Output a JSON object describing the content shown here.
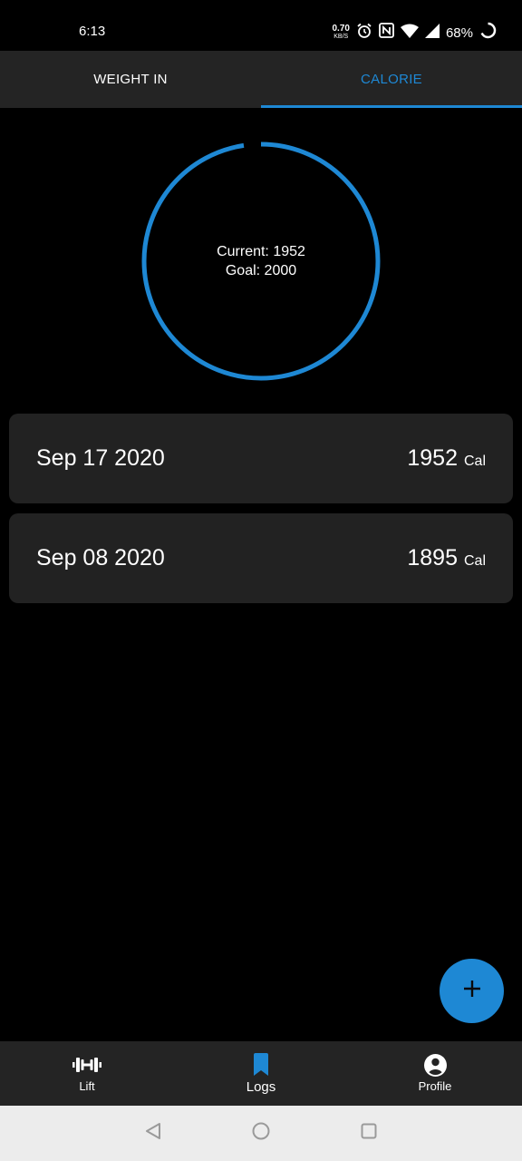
{
  "status_bar": {
    "time": "6:13",
    "net_speed_value": "0.70",
    "net_speed_unit": "KB/S",
    "battery_percent": "68%"
  },
  "tabs": [
    {
      "label": "WEIGHT IN",
      "active": false
    },
    {
      "label": "CALORIE",
      "active": true
    }
  ],
  "progress": {
    "current_label": "Current: 1952",
    "goal_label": "Goal: 2000",
    "current": 1952,
    "goal": 2000,
    "fraction": 0.976
  },
  "logs": [
    {
      "date": "Sep 17 2020",
      "value": "1952",
      "unit": "Cal"
    },
    {
      "date": "Sep 08 2020",
      "value": "1895",
      "unit": "Cal"
    }
  ],
  "bottom_nav": [
    {
      "label": "Lift",
      "icon": "dumbbell-icon",
      "active": false
    },
    {
      "label": "Logs",
      "icon": "bookmark-icon",
      "active": true
    },
    {
      "label": "Profile",
      "icon": "account-circle-icon",
      "active": false
    }
  ],
  "colors": {
    "accent": "#1e88d4",
    "background": "#000000",
    "surface": "#222222",
    "bar": "#242424"
  }
}
